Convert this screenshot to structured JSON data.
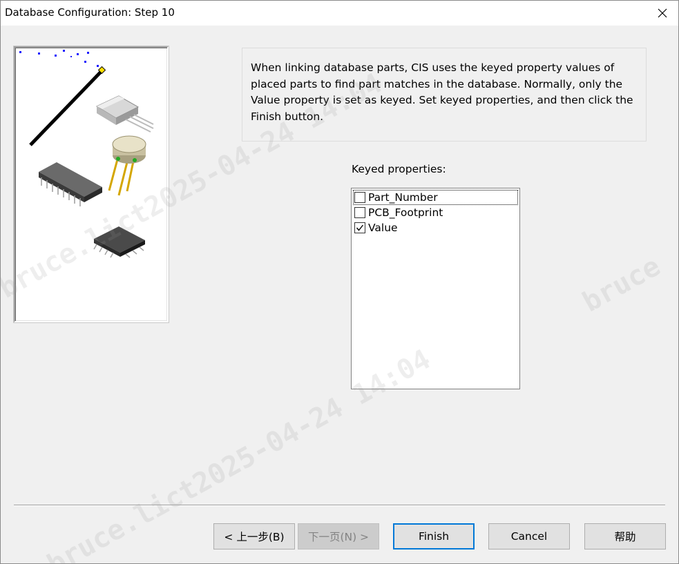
{
  "window": {
    "title": "Database Configuration: Step 10"
  },
  "info": {
    "text": "When linking database parts, CIS uses the keyed property values of placed parts to find part matches in the database. Normally, only the Value property is set as keyed. Set keyed properties, and then click the Finish button."
  },
  "keyed": {
    "label": "Keyed properties:",
    "items": [
      {
        "label": "Part_Number",
        "checked": false
      },
      {
        "label": "PCB_Footprint",
        "checked": false
      },
      {
        "label": "Value",
        "checked": true
      }
    ]
  },
  "buttons": {
    "back": "< 上一步(B)",
    "next": "下一页(N) >",
    "finish": "Finish",
    "cancel": "Cancel",
    "help": "帮助"
  },
  "watermark": {
    "lines": [
      "bruce.lict2025-04-24 14:04",
      "bruce.lict2025-04-24 14:04",
      "bruce"
    ]
  },
  "colors": {
    "accent": "#0078d7",
    "window_bg": "#f0f0f0"
  }
}
